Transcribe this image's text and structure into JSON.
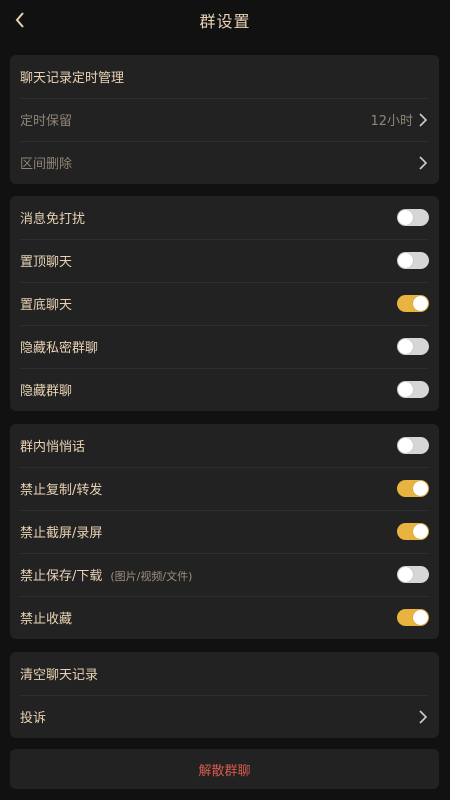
{
  "header": {
    "title": "群设置"
  },
  "colors": {
    "accent": "#e8b33e",
    "danger": "#d65a4e",
    "text": "#e8d2b4"
  },
  "group1": {
    "title": "聊天记录定时管理",
    "timer_label": "定时保留",
    "timer_value": "12小时",
    "range_delete_label": "区间删除"
  },
  "group2": {
    "mute": {
      "label": "消息免打扰",
      "on": false
    },
    "pin_top": {
      "label": "置顶聊天",
      "on": false
    },
    "pin_bottom": {
      "label": "置底聊天",
      "on": true
    },
    "hide_private": {
      "label": "隐藏私密群聊",
      "on": false
    },
    "hide_group": {
      "label": "隐藏群聊",
      "on": false
    }
  },
  "group3": {
    "whisper": {
      "label": "群内悄悄话",
      "on": false
    },
    "no_copy": {
      "label": "禁止复制/转发",
      "on": true
    },
    "no_screenshot": {
      "label": "禁止截屏/录屏",
      "on": true
    },
    "no_save": {
      "label": "禁止保存/下载",
      "sub": "(图片/视频/文件)",
      "on": false
    },
    "no_fav": {
      "label": "禁止收藏",
      "on": true
    }
  },
  "group4": {
    "clear_history": "清空聊天记录",
    "report": "投诉"
  },
  "dissolve": "解散群聊"
}
